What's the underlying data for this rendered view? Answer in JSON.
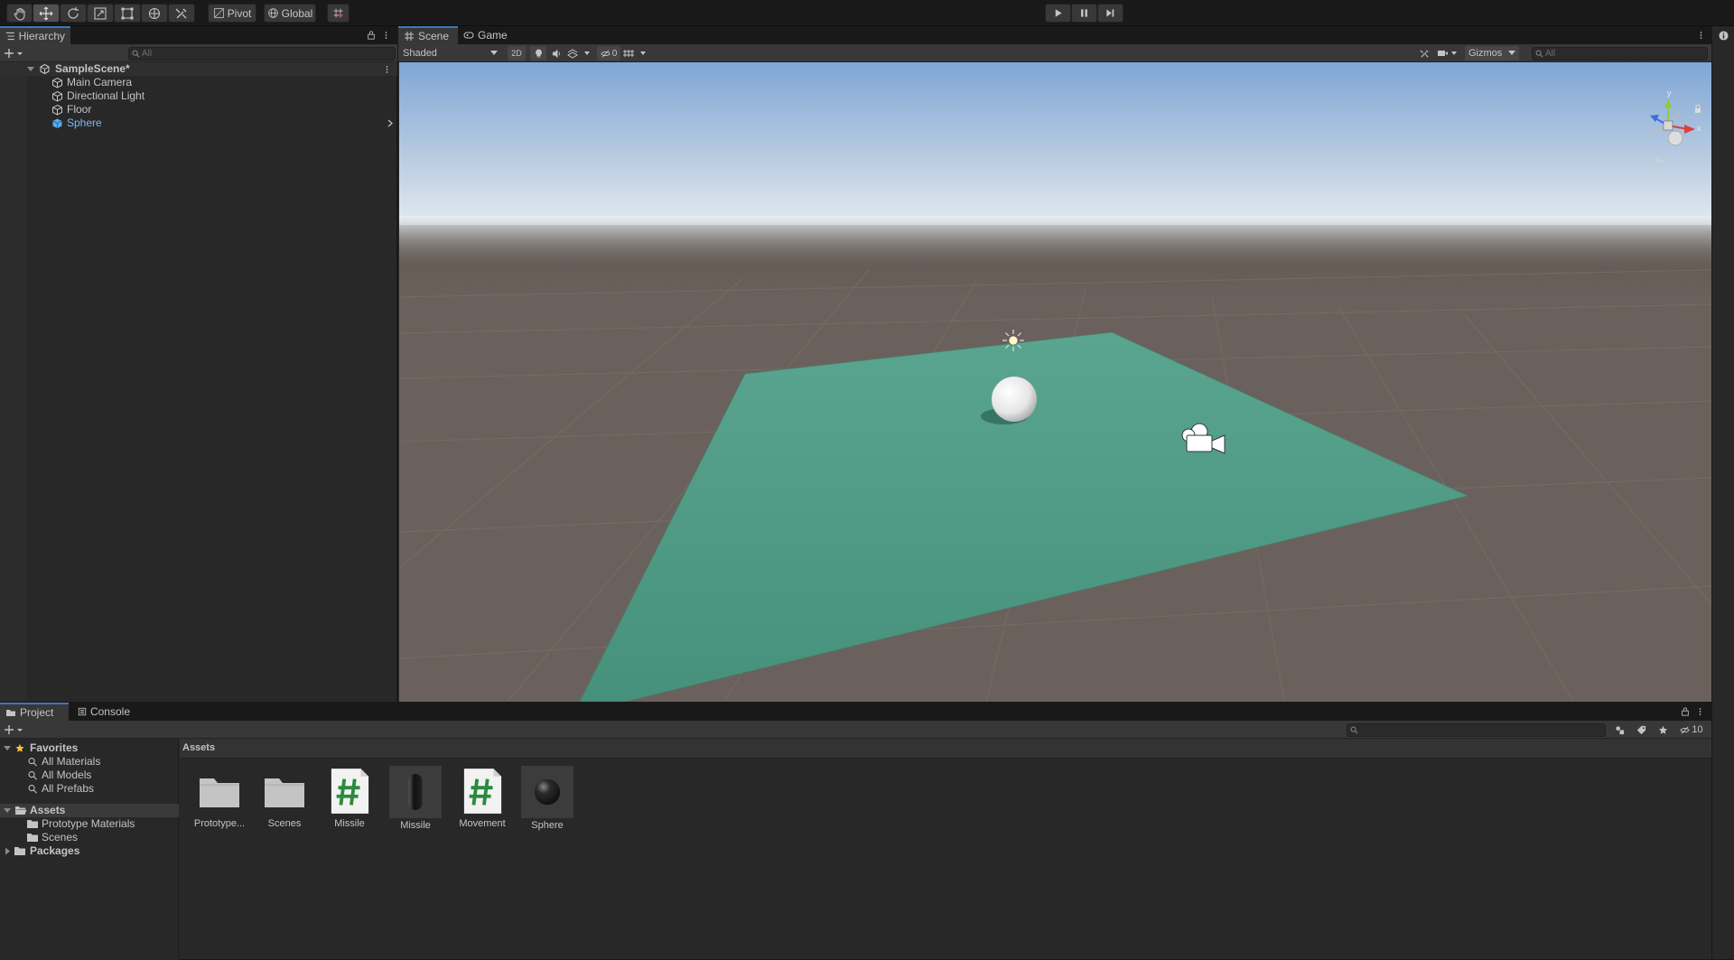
{
  "toolbar": {
    "tools": [
      "hand-tool",
      "move-tool",
      "rotate-tool",
      "scale-tool",
      "rect-tool",
      "transform-tool",
      "custom-tool"
    ],
    "pivot_label": "Pivot",
    "global_label": "Global",
    "snap_icon": "grid-snap-icon",
    "play_icon": "play-icon",
    "pause_icon": "pause-icon",
    "step_icon": "step-icon"
  },
  "hierarchy": {
    "tab_label": "Hierarchy",
    "search_placeholder": "All",
    "scene_name": "SampleScene*",
    "items": [
      {
        "label": "Main Camera",
        "selected": false
      },
      {
        "label": "Directional Light",
        "selected": false
      },
      {
        "label": "Floor",
        "selected": false
      },
      {
        "label": "Sphere",
        "selected": true
      }
    ]
  },
  "scene_view": {
    "tabs": [
      {
        "label": "Scene",
        "active": true
      },
      {
        "label": "Game",
        "active": false
      }
    ],
    "shading_mode": "Shaded",
    "mode_2d_label": "2D",
    "hidden_count": "0",
    "gizmos_label": "Gizmos",
    "search_placeholder": "All",
    "gizmo_axes": {
      "y": "y",
      "x": "x"
    },
    "colors": {
      "sky_top": "#7fa6d6",
      "horizon": "#e8eef3",
      "ground": "#6b615c",
      "floor": "#4f9f88",
      "y_axis": "#8fcc3c",
      "x_axis": "#d9413a",
      "z_axis": "#3b6fd6"
    }
  },
  "project": {
    "tabs": [
      {
        "label": "Project",
        "active": true
      },
      {
        "label": "Console",
        "active": false
      }
    ],
    "favorites_label": "Favorites",
    "favorites": [
      "All Materials",
      "All Models",
      "All Prefabs"
    ],
    "assets_label": "Assets",
    "asset_folders": [
      "Prototype Materials",
      "Scenes"
    ],
    "packages_label": "Packages",
    "breadcrumb": "Assets",
    "hidden_packages_count": "10",
    "assets": [
      {
        "name": "Prototype...",
        "kind": "folder"
      },
      {
        "name": "Scenes",
        "kind": "folder"
      },
      {
        "name": "Missile",
        "kind": "script"
      },
      {
        "name": "Missile",
        "kind": "capsule-prefab"
      },
      {
        "name": "Movement",
        "kind": "script"
      },
      {
        "name": "Sphere",
        "kind": "sphere-material"
      }
    ]
  }
}
